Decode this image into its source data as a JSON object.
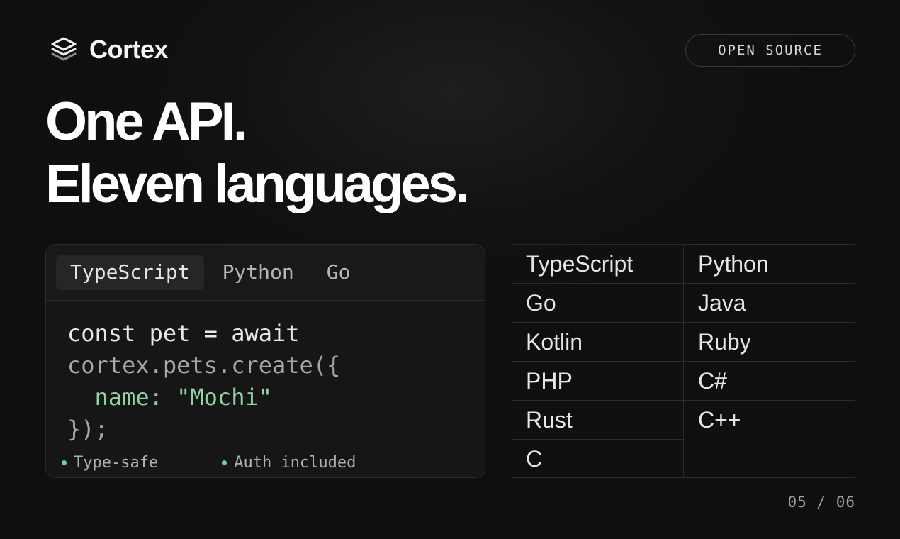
{
  "brand": {
    "name": "Cortex",
    "icon": "layers-stack-icon"
  },
  "badge": {
    "label": "OPEN SOURCE"
  },
  "headline": {
    "line1": "One API.",
    "line2": "Eleven languages."
  },
  "code_card": {
    "tabs": [
      {
        "label": "TypeScript",
        "active": true
      },
      {
        "label": "Python",
        "active": false
      },
      {
        "label": "Go",
        "active": false
      }
    ],
    "code_lines": {
      "line1": "const pet = await",
      "line2": "cortex.pets.create({",
      "line3": "  name: \"Mochi\"",
      "line4": "});"
    },
    "features": [
      "Type-safe",
      "Auth included"
    ]
  },
  "languages": {
    "left": [
      "TypeScript",
      "Go",
      "Kotlin",
      "PHP",
      "Rust",
      "C"
    ],
    "right": [
      "Python",
      "Java",
      "Ruby",
      "C#",
      "C++"
    ]
  },
  "pager": {
    "text": "05 / 06"
  },
  "colors": {
    "accent_green": "#8fd3a6",
    "dot_green": "#6fcf97",
    "background": "#111111"
  }
}
